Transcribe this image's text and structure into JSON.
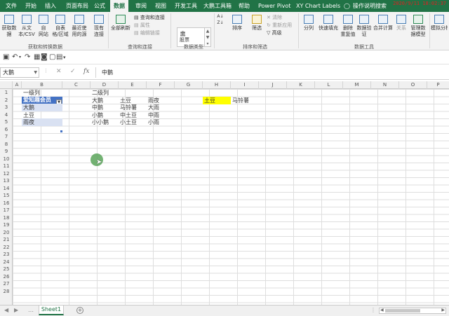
{
  "tabs": [
    "文件",
    "开始",
    "插入",
    "页面布局",
    "公式",
    "数据",
    "审阅",
    "视图",
    "开发工具",
    "大鹏工具箱",
    "帮助",
    "Power Pivot",
    "XY Chart Labels",
    "操作说明搜索"
  ],
  "active_tab": "数据",
  "datetime": "2020/9/11 18:02:37",
  "ribbon": {
    "btn_get": "获取数\n据",
    "btn_csv": "从文\n本/CSV",
    "btn_web": "自\n网站",
    "btn_table": "自表\n格/区域",
    "btn_recent": "最近使\n用的源",
    "btn_existing": "现有\n连接",
    "grp_get": "获取和转换数据",
    "btn_refresh": "全部刷新",
    "q_connections": "查询和连接",
    "q_properties": "属性",
    "q_editlinks": "编辑链接",
    "grp_query": "查询和连接",
    "style_value": "股票",
    "grp_types": "数据类型",
    "btn_sort": "排序",
    "btn_filter": "筛选",
    "s_clear": "清除",
    "s_reapply": "重新应用",
    "s_advanced": "高级",
    "grp_sort": "排序和筛选",
    "btn_split": "分列",
    "btn_flash": "快速填充",
    "btn_dup": "删除\n重复值",
    "btn_validate": "数据验\n证",
    "btn_consolidate": "合并计算",
    "btn_relations": "关系",
    "btn_model": "管理数\n据模型",
    "grp_tools": "数据工具",
    "btn_whatif": "模拟分析"
  },
  "formula_bar": {
    "name_box": "大鹅",
    "cancel": "✕",
    "confirm": "✓",
    "fx": "fx",
    "value": "中鹅"
  },
  "columns": [
    "A",
    "B",
    "C",
    "D",
    "E",
    "F",
    "G",
    "H",
    "I",
    "J",
    "K",
    "L",
    "M",
    "N",
    "O",
    "P"
  ],
  "rows": [
    "1",
    "2",
    "3",
    "4",
    "5",
    "6",
    "7",
    "8",
    "9",
    "10",
    "11",
    "12",
    "13",
    "14",
    "15",
    "16",
    "17",
    "18",
    "19",
    "20",
    "21",
    "22",
    "23",
    "24",
    "25",
    "26",
    "27",
    "28"
  ],
  "cells": {
    "B1": "一级列",
    "B2": "爱知趣会员",
    "B3": "大鹅",
    "B4": "土豆",
    "B5": "雨夜",
    "D1": "二级列",
    "D2": "大鹅",
    "E2": "土豆",
    "F2": "雨夜",
    "D3": "中鹅",
    "E3": "马铃薯",
    "F3": "大雨",
    "D4": "小鹅",
    "E4": "中土豆",
    "F4": "中雨",
    "D5": "小小鹅",
    "E5": "小土豆",
    "F5": "小雨",
    "H2": "土豆",
    "I2": "马铃薯"
  },
  "sheet_tab": "Sheet1",
  "colors": {
    "brand": "#217346",
    "table_header": "#4472c4",
    "table_band": "#d9e1f2",
    "highlight": "#ffff00",
    "cursor": "#5aa55a"
  }
}
